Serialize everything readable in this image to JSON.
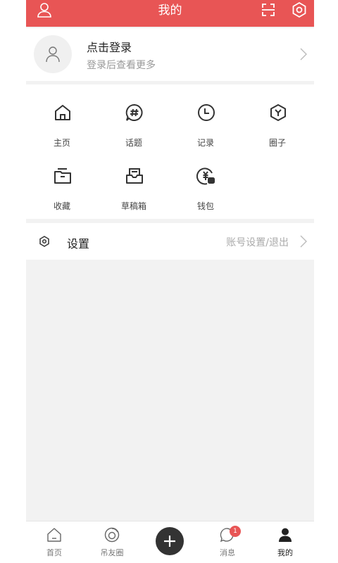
{
  "header": {
    "title": "我的",
    "left_icon": "user-icon",
    "right_icons": [
      "scan-icon",
      "gear-icon"
    ],
    "color": "#e85555"
  },
  "login": {
    "title": "点击登录",
    "subtitle": "登录后查看更多"
  },
  "grid": {
    "items": [
      {
        "label": "主页",
        "icon": "home-icon"
      },
      {
        "label": "话题",
        "icon": "hashtag-icon"
      },
      {
        "label": "记录",
        "icon": "clock-icon"
      },
      {
        "label": "圈子",
        "icon": "circle-hex-icon"
      },
      {
        "label": "收藏",
        "icon": "folder-icon"
      },
      {
        "label": "草稿箱",
        "icon": "drafts-icon"
      },
      {
        "label": "钱包",
        "icon": "wallet-icon"
      }
    ]
  },
  "settings": {
    "label": "设置",
    "hint": "账号设置/退出"
  },
  "tabbar": {
    "items": [
      {
        "label": "首页",
        "icon": "home-tab-icon"
      },
      {
        "label": "吊友圈",
        "icon": "camera-circle-icon"
      },
      {
        "label": "消息",
        "icon": "message-icon",
        "badge": "1"
      },
      {
        "label": "我的",
        "icon": "person-icon",
        "active": true
      }
    ],
    "add_icon": "plus-icon"
  }
}
